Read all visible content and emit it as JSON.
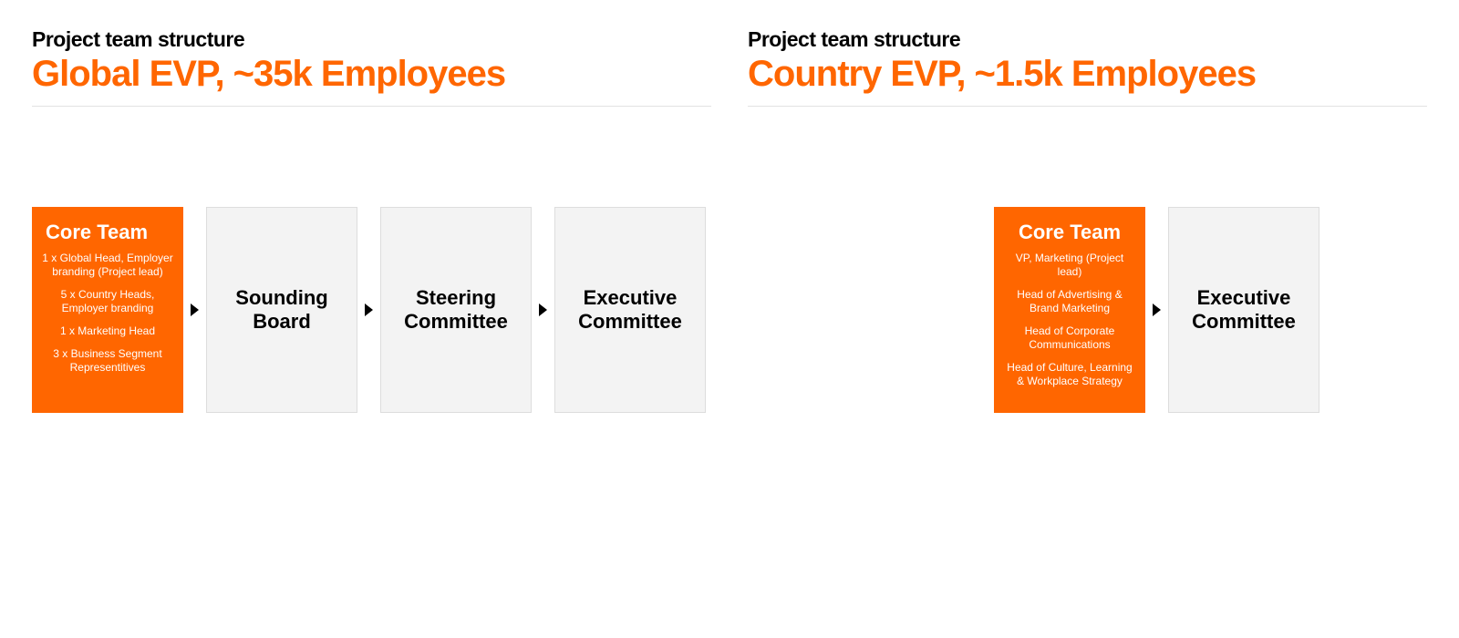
{
  "colors": {
    "accent": "#ff6600"
  },
  "left": {
    "kicker": "Project team structure",
    "headline": "Global EVP, ~35k Employees",
    "core_title": "Core Team",
    "core_items": [
      "1 x Global Head, Employer branding (Project lead)",
      "5 x Country Heads, Employer branding",
      "1 x Marketing Head",
      "3 x Business Segment Representitives"
    ],
    "boxes": [
      "Sounding Board",
      "Steering Committee",
      "Executive Committee"
    ]
  },
  "right": {
    "kicker": "Project team structure",
    "headline": "Country EVP, ~1.5k Employees",
    "core_title": "Core Team",
    "core_items": [
      "VP, Marketing (Project lead)",
      "Head of Advertising & Brand Marketing",
      "Head of Corporate Communications",
      "Head of Culture, Learning & Workplace Strategy"
    ],
    "boxes": [
      "Executive Committee"
    ]
  }
}
